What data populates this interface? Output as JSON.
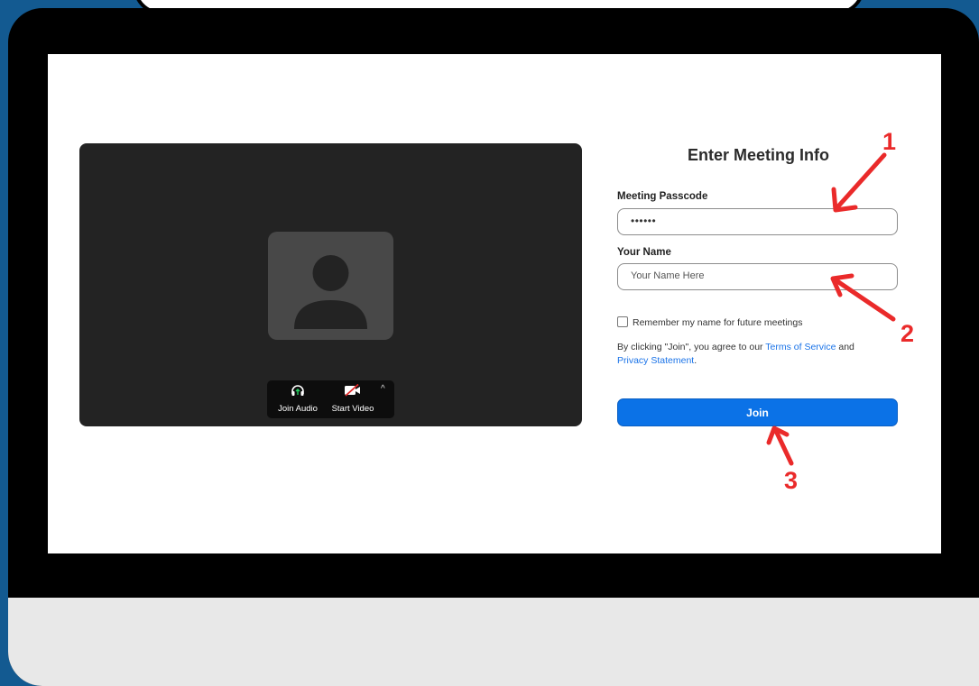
{
  "preview": {
    "join_audio_label": "Join Audio",
    "start_video_label": "Start Video",
    "caret": "^"
  },
  "form": {
    "title": "Enter Meeting Info",
    "passcode_label": "Meeting Passcode",
    "passcode_value": "••••••",
    "name_label": "Your Name",
    "name_placeholder": "Your Name Here",
    "remember_label": "Remember my name for future meetings",
    "remember_checked": false,
    "terms_prefix": "By clicking \"Join\", you agree to our ",
    "terms_link": "Terms of Service",
    "terms_and": " and ",
    "privacy_link": "Privacy Statement",
    "terms_suffix": ".",
    "join_label": "Join"
  },
  "annotations": {
    "step1": "1",
    "step2": "2",
    "step3": "3",
    "color": "#ea2a2a"
  },
  "icons": [
    "avatar-placeholder-icon",
    "headphones-icon",
    "video-off-icon",
    "chevron-up-icon"
  ]
}
